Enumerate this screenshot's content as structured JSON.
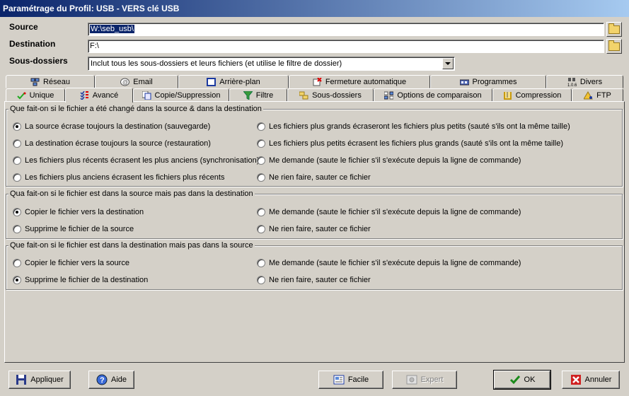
{
  "window": {
    "title": "Paramétrage du Profil: USB - VERS clé USB"
  },
  "fields": {
    "source": {
      "label": "Source",
      "value": "W:\\seb_usb\\"
    },
    "destination": {
      "label": "Destination",
      "value": "F:\\"
    },
    "subfolders": {
      "label": "Sous-dossiers",
      "value": "Inclut tous les sous-dossiers et leurs fichiers (et utilise le filtre de dossier)"
    }
  },
  "tabs_row1": [
    {
      "label": "Réseau",
      "icon": "network-icon"
    },
    {
      "label": "Email",
      "icon": "email-icon"
    },
    {
      "label": "Arrière-plan",
      "icon": "background-icon"
    },
    {
      "label": "Fermeture automatique",
      "icon": "auto-close-icon"
    },
    {
      "label": "Programmes",
      "icon": "programs-icon"
    },
    {
      "label": "Divers",
      "icon": "misc-icon"
    }
  ],
  "tabs_row2": [
    {
      "label": "Unique",
      "icon": "unique-icon"
    },
    {
      "label": "Avancé",
      "icon": "advanced-icon"
    },
    {
      "label": "Copie/Suppression",
      "icon": "copy-delete-icon"
    },
    {
      "label": "Filtre",
      "icon": "filter-icon"
    },
    {
      "label": "Sous-dossiers",
      "icon": "subfolders-icon"
    },
    {
      "label": "Options de comparaison",
      "icon": "compare-icon"
    },
    {
      "label": "Compression",
      "icon": "compression-icon"
    },
    {
      "label": "FTP",
      "icon": "ftp-icon"
    }
  ],
  "active_tab": "Avancé",
  "groups": [
    {
      "title": "Que fait-on si le fichier a été changé dans la source & dans la destination",
      "options": [
        {
          "label": "La source écrase toujours la destination (sauvegarde)",
          "checked": true
        },
        {
          "label": "Les fichiers plus grands écraseront les fichiers plus petits (sauté s'ils ont la même taille)",
          "checked": false
        },
        {
          "label": "La destination écrase toujours la source (restauration)",
          "checked": false
        },
        {
          "label": "Les fichiers plus petits écrasent les fichiers plus grands (sauté s'ils ont la même taille)",
          "checked": false
        },
        {
          "label": "Les fichiers plus récents écrasent les plus anciens (synchronisation)",
          "checked": false
        },
        {
          "label": "Me demande (saute le fichier s'il s'exécute depuis la ligne de commande)",
          "checked": false
        },
        {
          "label": "Les fichiers plus anciens écrasent les fichiers plus récents",
          "checked": false
        },
        {
          "label": "Ne rien faire, sauter ce fichier",
          "checked": false
        }
      ]
    },
    {
      "title": "Qua fait-on si le fichier est dans la source mais pas dans la destination",
      "options": [
        {
          "label": "Copier le fichier vers la destination",
          "checked": true
        },
        {
          "label": "Me demande (saute le fichier s'il s'exécute depuis la ligne de commande)",
          "checked": false
        },
        {
          "label": "Supprime le fichier de la source",
          "checked": false
        },
        {
          "label": "Ne rien faire, sauter ce fichier",
          "checked": false
        }
      ]
    },
    {
      "title": "Que fait-on si le fichier est dans la destination mais pas dans la source",
      "options": [
        {
          "label": "Copier le fichier vers la source",
          "checked": false
        },
        {
          "label": "Me demande (saute le fichier s'il s'exécute depuis la ligne de commande)",
          "checked": false
        },
        {
          "label": "Supprime le fichier de la destination",
          "checked": true
        },
        {
          "label": "Ne rien faire, sauter ce fichier",
          "checked": false
        }
      ]
    }
  ],
  "buttons": {
    "apply": "Appliquer",
    "help": "Aide",
    "easy": "Facile",
    "expert": "Expert",
    "ok": "OK",
    "cancel": "Annuler"
  }
}
